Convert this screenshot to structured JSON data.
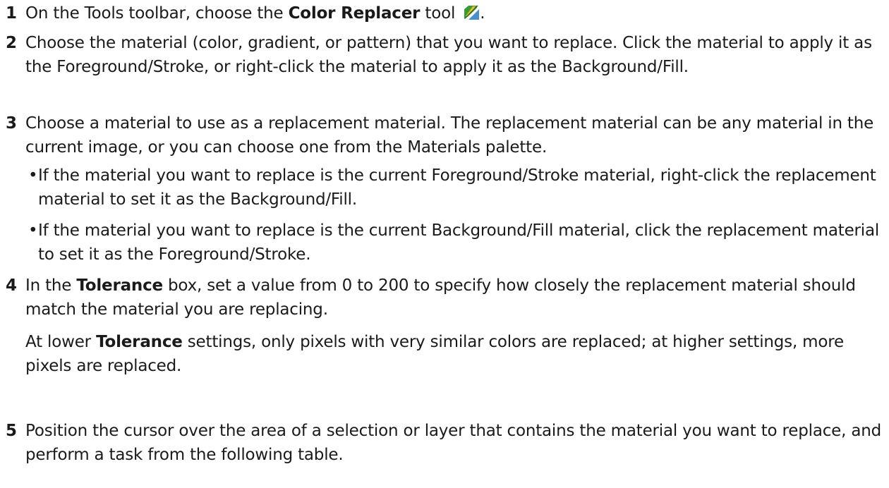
{
  "steps": [
    {
      "number": "1",
      "pre": "On the Tools toolbar, choose the ",
      "bold": "Color Replacer",
      "post": " tool",
      "end": "."
    },
    {
      "number": "2",
      "text": "Choose the material (color, gradient, or pattern) that you want to replace. Click the material to apply it as the Foreground/Stroke, or right-click the material to apply it as the Background/Fill."
    },
    {
      "number": "3",
      "text": "Choose a material to use as a replacement material. The replacement material can be any material in the current image, or you can choose one from the Materials palette.",
      "bullets": [
        "If the material you want to replace is the current Foreground/Stroke material, right-click the replacement material to set it as the Background/Fill.",
        "If the material you want to replace is the current Background/Fill material, click the replacement material to set it as the Foreground/Stroke."
      ]
    },
    {
      "number": "4",
      "pre": "In the ",
      "bold": "Tolerance",
      "post": " box, set a value from 0 to 200 to specify how closely the replacement material should match the material you are replacing.",
      "para2_pre": "At lower ",
      "para2_bold": "Tolerance",
      "para2_post": " settings, only pixels with very similar colors are replaced; at higher settings, more pixels are replaced."
    },
    {
      "number": "5",
      "text": "Position the cursor over the area of a selection or layer that contains the material you want to replace, and perform a task from the following table."
    }
  ],
  "icons": {
    "tool": "color-replacer-icon"
  },
  "colors": {
    "text": "#1a1a1a",
    "icon_blue": "#4a90c8",
    "icon_green": "#3a9a3a",
    "icon_yellow": "#e8c020"
  }
}
